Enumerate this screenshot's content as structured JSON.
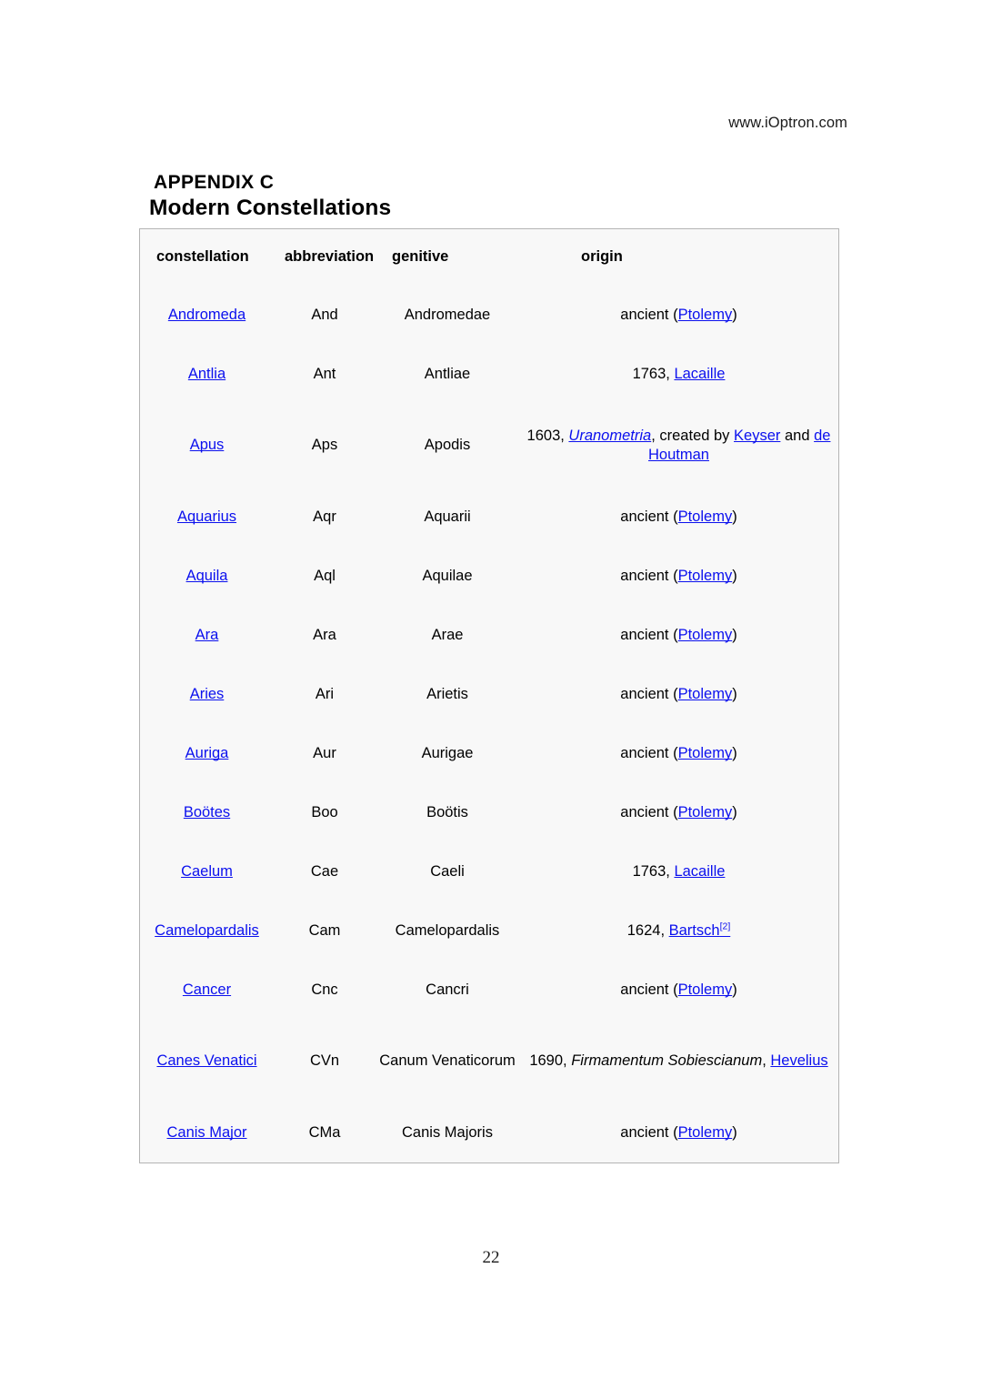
{
  "header": {
    "website": "www.iOptron.com"
  },
  "titles": {
    "appendix_label": "APPENDIX C",
    "appendix_title": "Modern Constellations"
  },
  "table": {
    "columns": [
      {
        "key": "constellation",
        "label": "constellation"
      },
      {
        "key": "abbreviation",
        "label": "abbreviation"
      },
      {
        "key": "genitive",
        "label": "genitive"
      },
      {
        "key": "origin",
        "label": "origin"
      }
    ],
    "rows": [
      {
        "constellation": "Andromeda",
        "abbreviation": "And",
        "genitive": "Andromedae",
        "origin_text": "ancient (Ptolemy)",
        "origin_parts": [
          {
            "text": "ancient (",
            "style": "plain"
          },
          {
            "text": "Ptolemy",
            "style": "link"
          },
          {
            "text": ")",
            "style": "plain"
          }
        ]
      },
      {
        "constellation": "Antlia",
        "abbreviation": "Ant",
        "genitive": "Antliae",
        "origin_text": "1763, Lacaille",
        "origin_parts": [
          {
            "text": "1763, ",
            "style": "plain"
          },
          {
            "text": "Lacaille",
            "style": "link"
          }
        ]
      },
      {
        "constellation": "Apus",
        "abbreviation": "Aps",
        "genitive": "Apodis",
        "origin_text": "1603, Uranometria, created by Keyser and de Houtman",
        "origin_parts": [
          {
            "text": "1603, ",
            "style": "plain"
          },
          {
            "text": "Uranometria",
            "style": "link-italic"
          },
          {
            "text": ", created by ",
            "style": "plain"
          },
          {
            "text": "Keyser",
            "style": "link"
          },
          {
            "text": " and ",
            "style": "plain"
          },
          {
            "text": "de Houtman",
            "style": "link"
          }
        ]
      },
      {
        "constellation": "Aquarius",
        "abbreviation": "Aqr",
        "genitive": "Aquarii",
        "origin_text": "ancient (Ptolemy)",
        "origin_parts": [
          {
            "text": "ancient (",
            "style": "plain"
          },
          {
            "text": "Ptolemy",
            "style": "link"
          },
          {
            "text": ")",
            "style": "plain"
          }
        ]
      },
      {
        "constellation": "Aquila",
        "abbreviation": "Aql",
        "genitive": "Aquilae",
        "origin_text": "ancient (Ptolemy)",
        "origin_parts": [
          {
            "text": "ancient (",
            "style": "plain"
          },
          {
            "text": "Ptolemy",
            "style": "link"
          },
          {
            "text": ")",
            "style": "plain"
          }
        ]
      },
      {
        "constellation": "Ara",
        "abbreviation": "Ara",
        "genitive": "Arae",
        "origin_text": "ancient (Ptolemy)",
        "origin_parts": [
          {
            "text": "ancient (",
            "style": "plain"
          },
          {
            "text": "Ptolemy",
            "style": "link"
          },
          {
            "text": ")",
            "style": "plain"
          }
        ]
      },
      {
        "constellation": "Aries",
        "abbreviation": "Ari",
        "genitive": "Arietis",
        "origin_text": "ancient (Ptolemy)",
        "origin_parts": [
          {
            "text": "ancient (",
            "style": "plain"
          },
          {
            "text": "Ptolemy",
            "style": "link"
          },
          {
            "text": ")",
            "style": "plain"
          }
        ]
      },
      {
        "constellation": "Auriga",
        "abbreviation": "Aur",
        "genitive": "Aurigae",
        "origin_text": "ancient (Ptolemy)",
        "origin_parts": [
          {
            "text": "ancient (",
            "style": "plain"
          },
          {
            "text": "Ptolemy",
            "style": "link"
          },
          {
            "text": ")",
            "style": "plain"
          }
        ]
      },
      {
        "constellation": "Boötes",
        "abbreviation": "Boo",
        "genitive": "Boötis",
        "origin_text": "ancient (Ptolemy)",
        "origin_parts": [
          {
            "text": "ancient (",
            "style": "plain"
          },
          {
            "text": "Ptolemy",
            "style": "link"
          },
          {
            "text": ")",
            "style": "plain"
          }
        ]
      },
      {
        "constellation": "Caelum",
        "abbreviation": "Cae",
        "genitive": "Caeli",
        "origin_text": "1763, Lacaille",
        "origin_parts": [
          {
            "text": "1763, ",
            "style": "plain"
          },
          {
            "text": "Lacaille",
            "style": "link"
          }
        ]
      },
      {
        "constellation": "Camelopardalis",
        "abbreviation": "Cam",
        "genitive": "Camelopardalis",
        "origin_text": "1624, Bartsch[2]",
        "origin_parts": [
          {
            "text": "1624, ",
            "style": "plain"
          },
          {
            "text": "Bartsch",
            "style": "link"
          },
          {
            "text": "[2]",
            "style": "link-sup"
          }
        ]
      },
      {
        "constellation": "Cancer",
        "abbreviation": "Cnc",
        "genitive": "Cancri",
        "origin_text": "ancient (Ptolemy)",
        "origin_parts": [
          {
            "text": "ancient (",
            "style": "plain"
          },
          {
            "text": "Ptolemy",
            "style": "link"
          },
          {
            "text": ")",
            "style": "plain"
          }
        ]
      },
      {
        "constellation": "Canes Venatici",
        "abbreviation": "CVn",
        "genitive": "Canum Venaticorum",
        "origin_text": "1690, Firmamentum Sobiescianum, Hevelius",
        "origin_parts": [
          {
            "text": "1690, ",
            "style": "plain"
          },
          {
            "text": "Firmamentum Sobiescianum",
            "style": "italic"
          },
          {
            "text": ", ",
            "style": "plain"
          },
          {
            "text": "Hevelius",
            "style": "link"
          }
        ]
      },
      {
        "constellation": "Canis Major",
        "abbreviation": "CMa",
        "genitive": "Canis Majoris",
        "origin_text": "ancient (Ptolemy)",
        "origin_parts": [
          {
            "text": "ancient (",
            "style": "plain"
          },
          {
            "text": "Ptolemy",
            "style": "link"
          },
          {
            "text": ")",
            "style": "plain"
          }
        ]
      }
    ]
  },
  "footer": {
    "page_number": "22"
  },
  "colors": {
    "link": "#0b10ee",
    "table_border": "#b4b4b4",
    "table_background": "#f8f8f8",
    "text": "#000000"
  }
}
